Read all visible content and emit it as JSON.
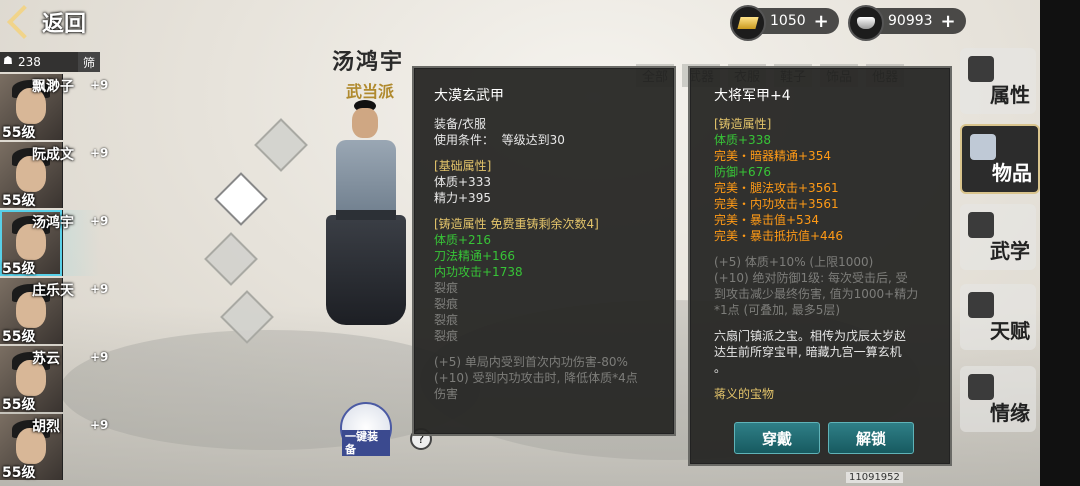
{
  "topbar": {
    "back_label": "返回",
    "gold": "1050",
    "silver": "90993",
    "plus": "+"
  },
  "roster": {
    "count": "238",
    "filter_label": "筛",
    "members": [
      {
        "name": "飘渺子",
        "plus": "+9",
        "level": "55级",
        "selected": false
      },
      {
        "name": "阮成文",
        "plus": "+9",
        "level": "55级",
        "selected": false
      },
      {
        "name": "汤鸿宇",
        "plus": "+9",
        "level": "55级",
        "selected": true
      },
      {
        "name": "庄乐天",
        "plus": "+9",
        "level": "55级",
        "selected": false
      },
      {
        "name": "苏云",
        "plus": "+9",
        "level": "55级",
        "selected": false
      },
      {
        "name": "胡烈",
        "plus": "+9",
        "level": "55级",
        "selected": false
      }
    ]
  },
  "hero": {
    "name": "汤鸿宇",
    "sect": "武当派",
    "one_key_label": "一键装备"
  },
  "category_tabs": [
    "全部",
    "武器",
    "衣服",
    "鞋子",
    "饰品",
    "他器"
  ],
  "item_left": {
    "title": "大漠玄武甲",
    "type": "装备/衣服",
    "use_cond_label": "使用条件：",
    "use_cond_value": "等级达到30",
    "basic_header": "[基础属性]",
    "basic": [
      "体质+333",
      "精力+395"
    ],
    "forge_header": "[铸造属性  免费重铸剩余次数4]",
    "forge": [
      "体质+216",
      "刀法精通+166",
      "内功攻击+1738"
    ],
    "cracks": [
      "裂痕",
      "裂痕",
      "裂痕",
      "裂痕"
    ],
    "effects": [
      "(+5) 单局内受到首次内功伤害-80%",
      "(+10) 受到内功攻击时, 降低体质*4点",
      "伤害"
    ]
  },
  "item_right": {
    "title": "大将军甲+4",
    "forge_header": "[铸造属性]",
    "forge": [
      {
        "text": "体质+338",
        "tone": "green"
      },
      {
        "text": "完美・暗器精通+354",
        "tone": "orange"
      },
      {
        "text": "防御+676",
        "tone": "green"
      },
      {
        "text": "完美・腿法攻击+3561",
        "tone": "orange"
      },
      {
        "text": "完美・内功攻击+3561",
        "tone": "orange"
      },
      {
        "text": "完美・暴击值+534",
        "tone": "orange"
      },
      {
        "text": "完美・暴击抵抗值+446",
        "tone": "orange"
      }
    ],
    "effects": [
      "(+5) 体质+10% (上限1000)",
      "(+10) 绝对防御1级: 每次受击后, 受",
      "到攻击减少最终伤害, 值为1000+精力",
      "*1点 (可叠加, 最多5层)"
    ],
    "description": [
      "六扇门镇派之宝。相传为戊辰太岁赵",
      "达生前所穿宝甲, 暗藏九宫一算玄机",
      "。"
    ],
    "treasure": "蒋义的宝物",
    "wear_label": "穿戴",
    "unlock_label": "解锁"
  },
  "sidenav": [
    {
      "label": "属性",
      "icon": "attribute-icon",
      "active": false
    },
    {
      "label": "物品",
      "icon": "gift-box-icon",
      "active": true
    },
    {
      "label": "武学",
      "icon": "martial-arts-icon",
      "active": false
    },
    {
      "label": "天赋",
      "icon": "talent-icon",
      "active": false
    },
    {
      "label": "情缘",
      "icon": "heart-bond-icon",
      "active": false
    }
  ],
  "footnote": "11091952",
  "colors": {
    "gold_text": "#e2c36a",
    "green_text": "#37c437",
    "orange_text": "#ff9a16",
    "button_teal": "#2f7f87",
    "selection_cyan": "#58d0e8"
  }
}
